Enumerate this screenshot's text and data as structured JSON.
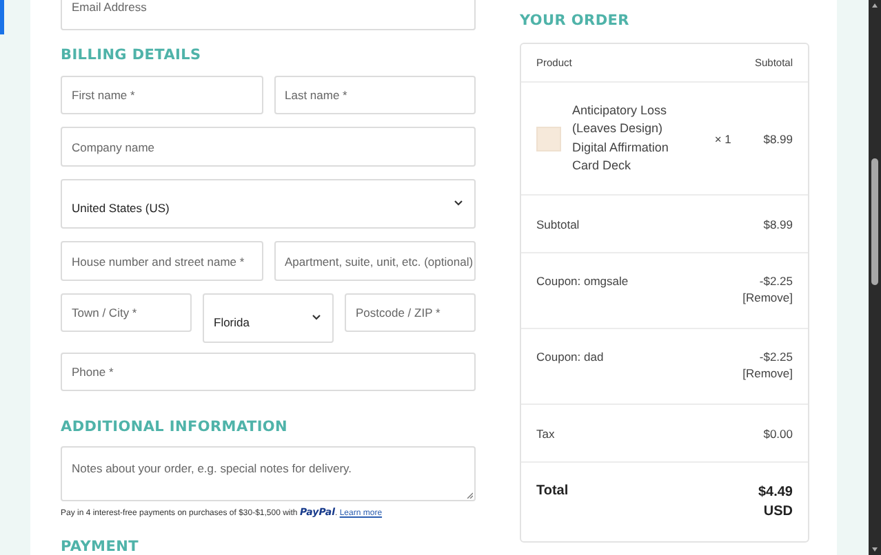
{
  "email_field": {
    "placeholder": "Email Address"
  },
  "billing": {
    "heading": "BILLING DETAILS",
    "rows": [
      [
        {
          "kind": "text",
          "placeholder": "First name *"
        },
        {
          "kind": "text",
          "placeholder": "Last name *"
        }
      ],
      [
        {
          "kind": "text",
          "placeholder": "Company name"
        }
      ],
      [
        {
          "kind": "select",
          "value": "United States (US)"
        }
      ],
      [
        {
          "kind": "text",
          "placeholder": "House number and street name *"
        },
        {
          "kind": "text",
          "placeholder": "Apartment, suite, unit, etc. (optional)"
        }
      ],
      [
        {
          "kind": "text",
          "placeholder": "Town / City *"
        },
        {
          "kind": "select",
          "value": "Florida"
        },
        {
          "kind": "text",
          "placeholder": "Postcode / ZIP *"
        }
      ],
      [
        {
          "kind": "text",
          "placeholder": "Phone *"
        }
      ]
    ]
  },
  "additional": {
    "heading": "ADDITIONAL INFORMATION",
    "notes": {
      "placeholder": "Notes about your order, e.g. special notes for delivery."
    },
    "paypal_message": {
      "text": "Pay in 4 interest-free payments on purchases of $30-$1,500 with",
      "logo": "PayPal",
      "after_logo": ".",
      "link": "Learn more"
    }
  },
  "payment": {
    "heading": "PAYMENT"
  },
  "order": {
    "heading": "YOUR ORDER",
    "columns": [
      "Product",
      "Subtotal"
    ],
    "product": {
      "name": "Anticipatory Loss (Leaves Design) Digital Affirmation Card Deck",
      "quantity": "× 1",
      "price": "$8.99"
    },
    "lines": [
      {
        "kind": "line",
        "label": "Subtotal",
        "value": "$8.99"
      },
      {
        "kind": "coupon",
        "label": "Coupon: omgsale",
        "value": "-$2.25",
        "action": "[Remove]"
      },
      {
        "kind": "coupon",
        "label": "Coupon: dad",
        "value": "-$2.25",
        "action": "[Remove]"
      },
      {
        "kind": "line",
        "label": "Tax",
        "value": "$0.00"
      },
      {
        "kind": "total",
        "label": "Total",
        "value": "$4.49 USD"
      }
    ]
  }
}
